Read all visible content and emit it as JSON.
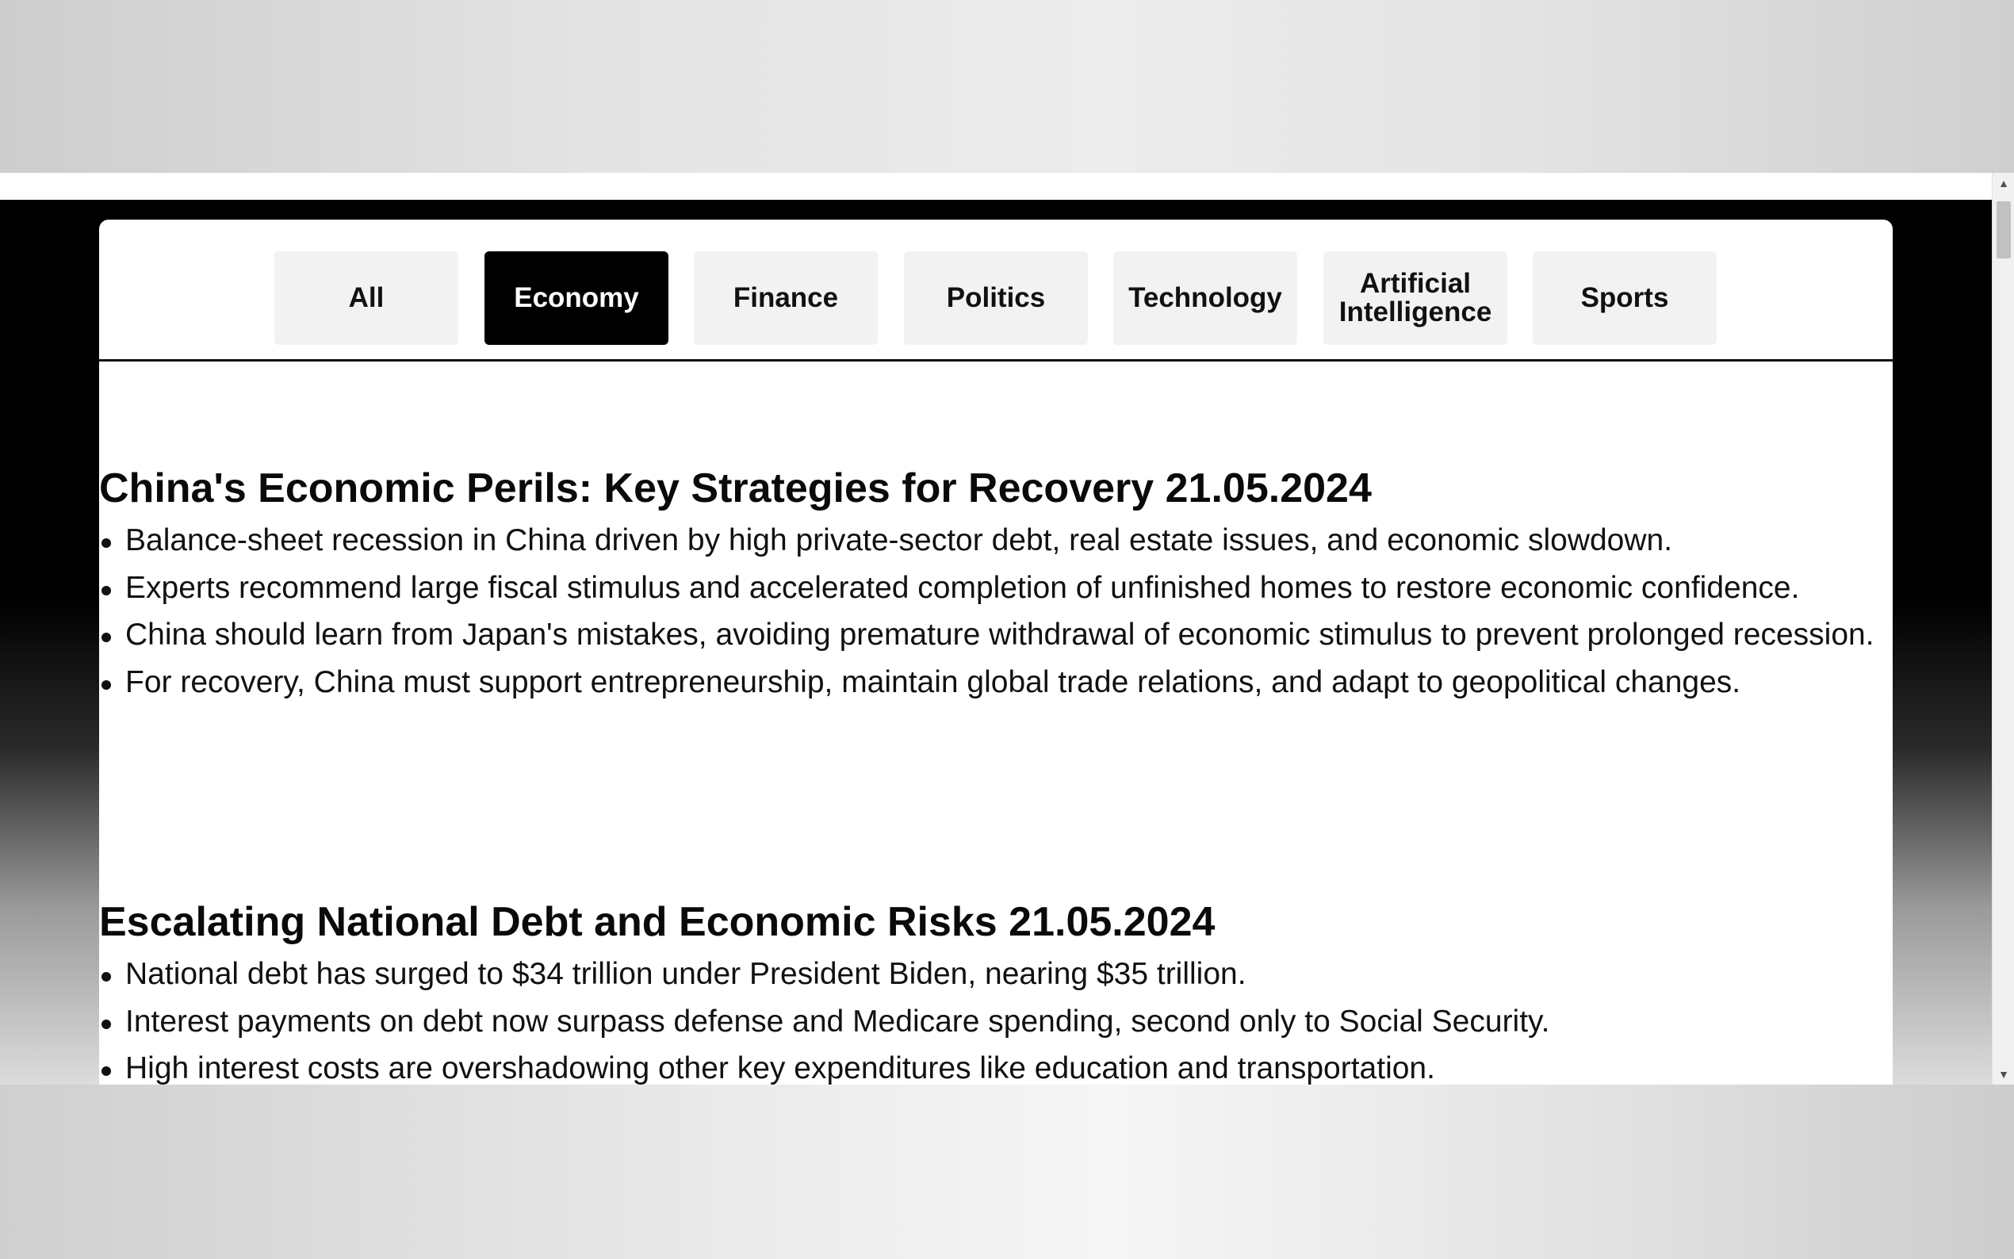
{
  "tabs": [
    {
      "label": "All",
      "active": false
    },
    {
      "label": "Economy",
      "active": true
    },
    {
      "label": "Finance",
      "active": false
    },
    {
      "label": "Politics",
      "active": false
    },
    {
      "label": "Technology",
      "active": false
    },
    {
      "label": "Artificial Intelligence",
      "active": false
    },
    {
      "label": "Sports",
      "active": false
    }
  ],
  "articles": [
    {
      "title": "China's Economic Perils: Key Strategies for Recovery 21.05.2024",
      "bullets": [
        "Balance-sheet recession in China driven by high private-sector debt, real estate issues, and economic slowdown.",
        "Experts recommend large fiscal stimulus and accelerated completion of unfinished homes to restore economic confidence.",
        "China should learn from Japan's mistakes, avoiding premature withdrawal of economic stimulus to prevent prolonged recession.",
        "For recovery, China must support entrepreneurship, maintain global trade relations, and adapt to geopolitical changes."
      ]
    },
    {
      "title": "Escalating National Debt and Economic Risks 21.05.2024",
      "bullets": [
        "National debt has surged to $34 trillion under President Biden, nearing $35 trillion.",
        "Interest payments on debt now surpass defense and Medicare spending, second only to Social Security.",
        "High interest costs are overshadowing other key expenditures like education and transportation."
      ]
    }
  ],
  "scrollbar": {
    "up_icon": "triangle-up",
    "down_icon": "triangle-down"
  },
  "colors": {
    "active_tab_bg": "#000000",
    "tab_bg": "#f2f2f2",
    "page_bg": "#000000",
    "card_bg": "#ffffff"
  }
}
